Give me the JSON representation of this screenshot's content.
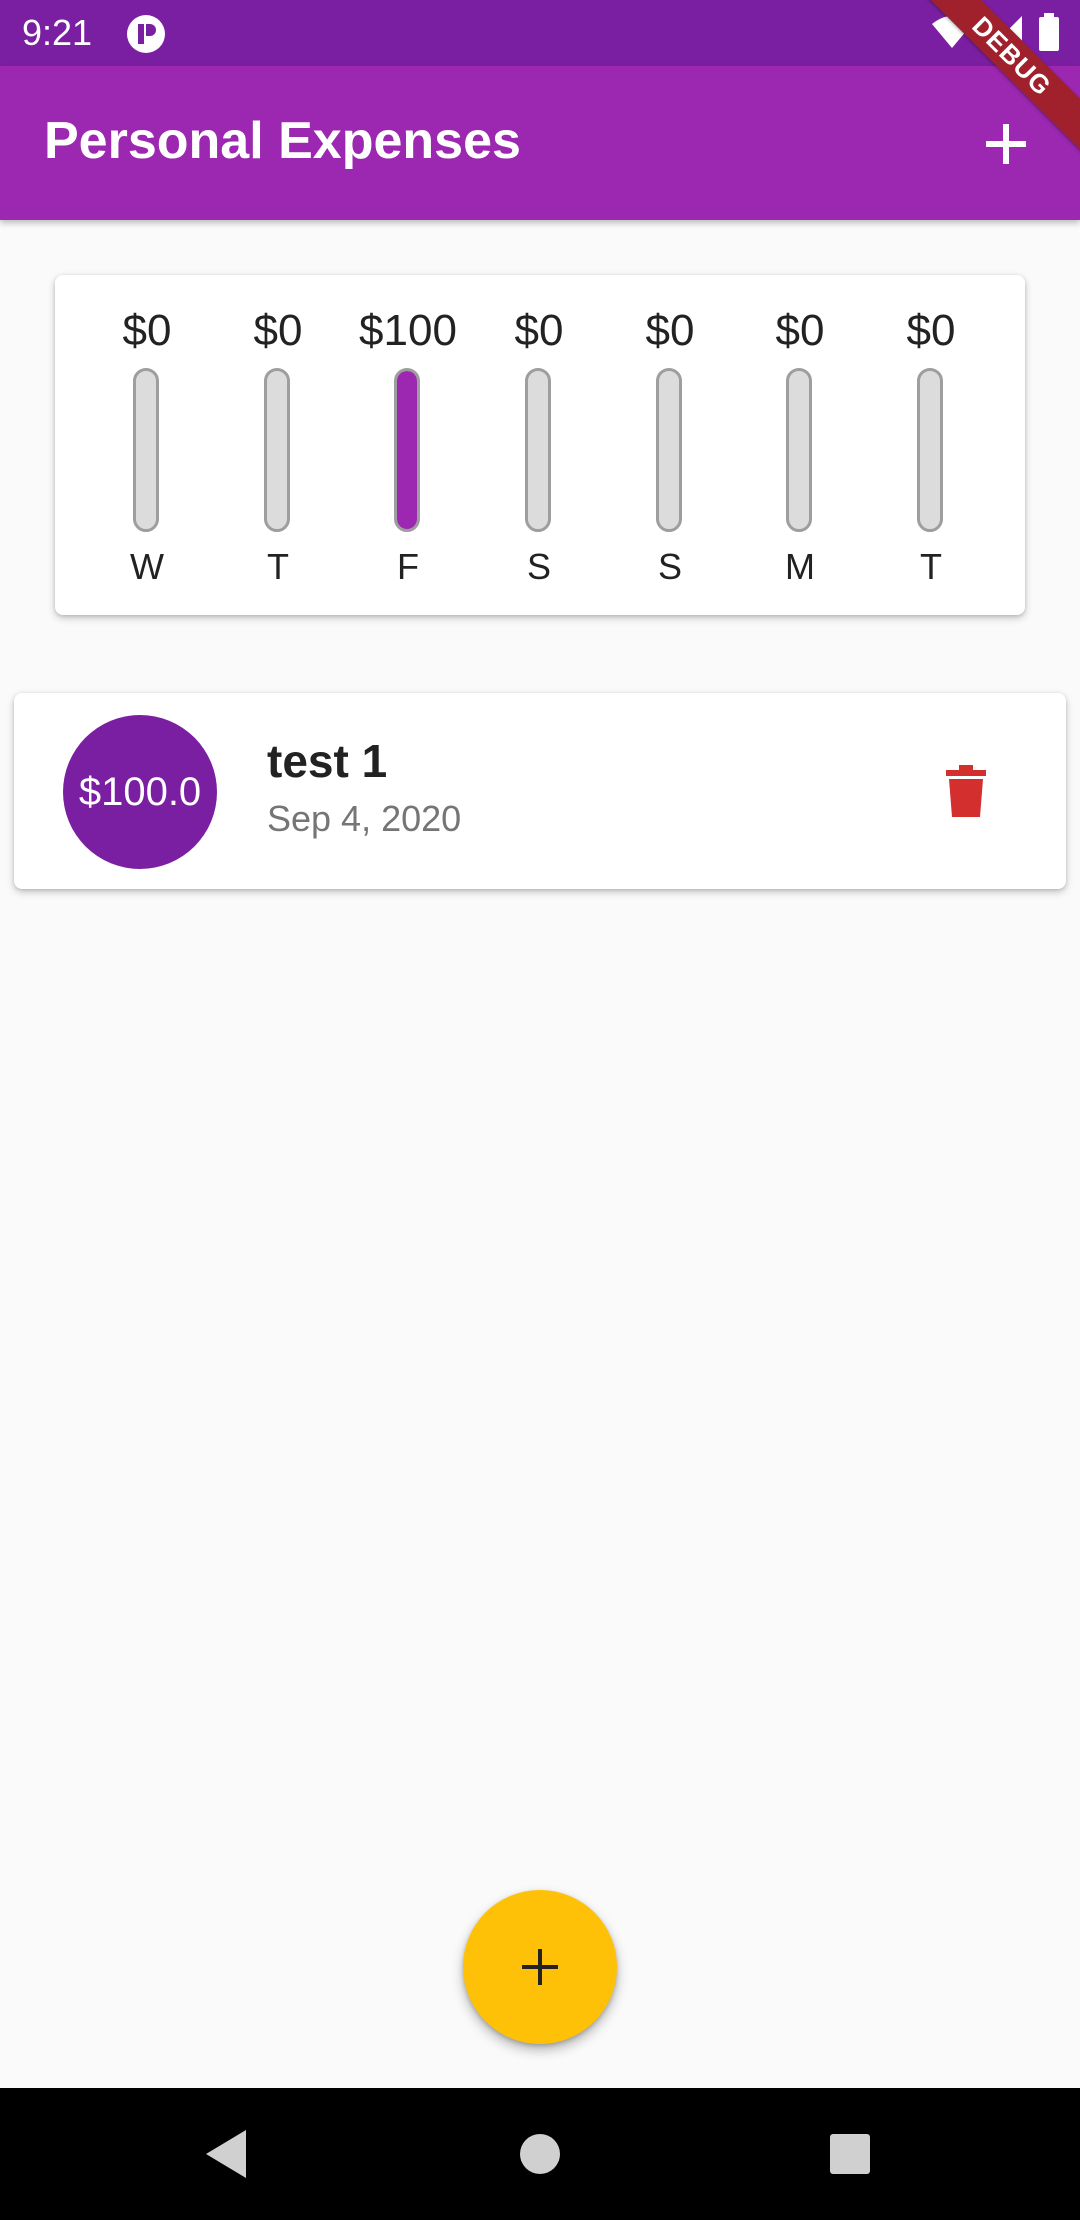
{
  "status_bar": {
    "time": "9:21",
    "icons": [
      "app-notification-icon",
      "wifi-icon",
      "signal-icon",
      "battery-icon"
    ]
  },
  "app_bar": {
    "title": "Personal Expenses",
    "add_icon": "plus-icon",
    "debug_label": "DEBUG",
    "color": "#9c27b0"
  },
  "chart": {
    "bars": [
      {
        "amount": "$0",
        "day": "W",
        "fraction": 0
      },
      {
        "amount": "$0",
        "day": "T",
        "fraction": 0
      },
      {
        "amount": "$100",
        "day": "F",
        "fraction": 1
      },
      {
        "amount": "$0",
        "day": "S",
        "fraction": 0
      },
      {
        "amount": "$0",
        "day": "S",
        "fraction": 0
      },
      {
        "amount": "$0",
        "day": "M",
        "fraction": 0
      },
      {
        "amount": "$0",
        "day": "T",
        "fraction": 0
      }
    ],
    "fill_color": "#9c27b0"
  },
  "transactions": [
    {
      "amount": "$100.0",
      "title": "test 1",
      "date": "Sep 4, 2020",
      "delete_icon": "trash-icon",
      "delete_color": "#d32f2f"
    }
  ],
  "fab": {
    "icon": "plus-icon",
    "color": "#ffc107"
  },
  "nav_bar": {
    "icons": [
      "back-icon",
      "home-icon",
      "recents-icon"
    ]
  }
}
